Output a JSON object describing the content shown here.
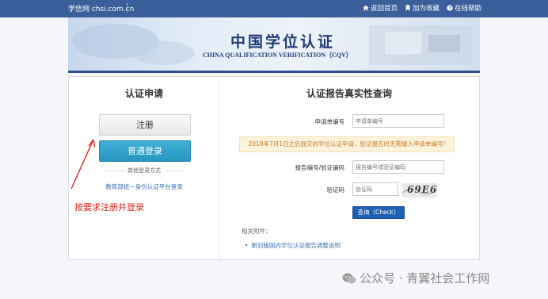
{
  "topbar": {
    "brand": "学信网 chsi.com.cn",
    "links": [
      "返回首页",
      "加为收藏",
      "在线帮助"
    ]
  },
  "banner": {
    "title": "中国学位认证",
    "subtitle": "CHINA QUALIFICATION VERIFICATION（CQV）"
  },
  "left": {
    "title": "认证申请",
    "register_label": "注册",
    "login_label": "普通登录",
    "other_login": "其他登录方式",
    "edu_link": "教育部统一身份认证平台登录"
  },
  "right": {
    "title": "认证报告真实性查询",
    "app_no_label": "申请单编号",
    "app_no_placeholder": "申请单编号",
    "notice": "2018年7月1日之后提交的学位认证申请，验证报告时无需输入申请单编号!",
    "report_label": "报告编号/验证编码",
    "report_placeholder": "报告编号或验证编码",
    "captcha_label": "验证码",
    "captcha_placeholder": "验证码",
    "captcha_text": "69E6",
    "query_label": "查询（Check）",
    "attach_title": "相关附件：",
    "attach_link": "新旧版国内学位认证报告调整说明"
  },
  "annotation": "按要求注册并登录",
  "watermark": "公众号 · 青翼社会工作网",
  "colors": {
    "topbar": "#3b5f9a",
    "login_button": "#2896c1",
    "query_button": "#1f5fb4",
    "annotation": "#e0261f"
  }
}
